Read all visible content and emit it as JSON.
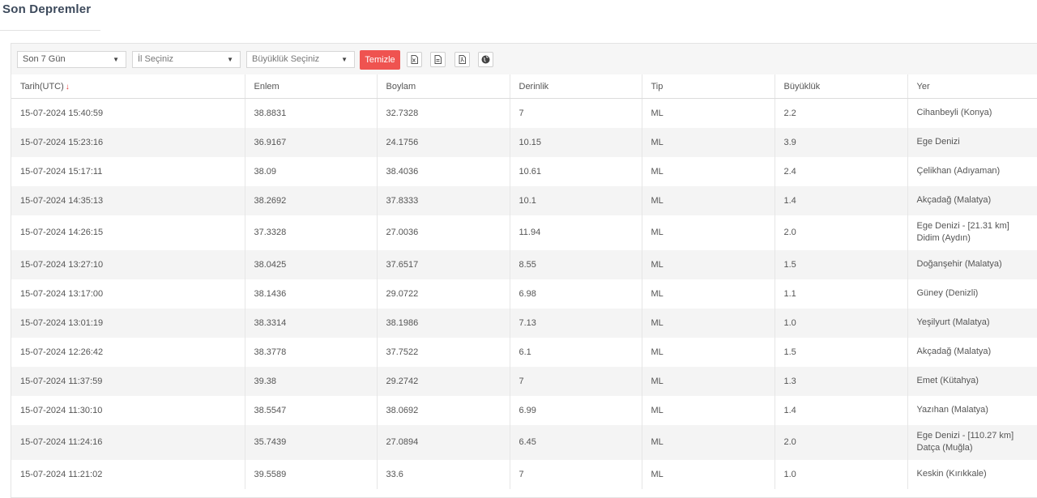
{
  "page": {
    "title": "Son Depremler"
  },
  "filters": {
    "period": "Son 7 Gün",
    "province": "İl Seçiniz",
    "magnitude": "Büyüklük Seçiniz",
    "clear_label": "Temizle"
  },
  "export_icons": [
    "excel-icon",
    "csv-icon",
    "pdf-icon",
    "globe-icon"
  ],
  "columns": [
    "Tarih(UTC)",
    "Enlem",
    "Boylam",
    "Derinlik",
    "Tip",
    "Büyüklük",
    "Yer"
  ],
  "sort": {
    "column": "Tarih(UTC)",
    "direction": "desc",
    "indicator": "↓"
  },
  "rows": [
    {
      "date": "15-07-2024 15:40:59",
      "lat": "38.8831",
      "lon": "32.7328",
      "depth": "7",
      "type": "ML",
      "mag": "2.2",
      "loc": "Cihanbeyli (Konya)"
    },
    {
      "date": "15-07-2024 15:23:16",
      "lat": "36.9167",
      "lon": "24.1756",
      "depth": "10.15",
      "type": "ML",
      "mag": "3.9",
      "loc": "Ege Denizi"
    },
    {
      "date": "15-07-2024 15:17:11",
      "lat": "38.09",
      "lon": "38.4036",
      "depth": "10.61",
      "type": "ML",
      "mag": "2.4",
      "loc": "Çelikhan (Adıyaman)"
    },
    {
      "date": "15-07-2024 14:35:13",
      "lat": "38.2692",
      "lon": "37.8333",
      "depth": "10.1",
      "type": "ML",
      "mag": "1.4",
      "loc": "Akçadağ (Malatya)"
    },
    {
      "date": "15-07-2024 14:26:15",
      "lat": "37.3328",
      "lon": "27.0036",
      "depth": "11.94",
      "type": "ML",
      "mag": "2.0",
      "loc": "Ege Denizi - [21.31 km] Didim (Aydın)"
    },
    {
      "date": "15-07-2024 13:27:10",
      "lat": "38.0425",
      "lon": "37.6517",
      "depth": "8.55",
      "type": "ML",
      "mag": "1.5",
      "loc": "Doğanşehir (Malatya)"
    },
    {
      "date": "15-07-2024 13:17:00",
      "lat": "38.1436",
      "lon": "29.0722",
      "depth": "6.98",
      "type": "ML",
      "mag": "1.1",
      "loc": "Güney (Denizli)"
    },
    {
      "date": "15-07-2024 13:01:19",
      "lat": "38.3314",
      "lon": "38.1986",
      "depth": "7.13",
      "type": "ML",
      "mag": "1.0",
      "loc": "Yeşilyurt (Malatya)"
    },
    {
      "date": "15-07-2024 12:26:42",
      "lat": "38.3778",
      "lon": "37.7522",
      "depth": "6.1",
      "type": "ML",
      "mag": "1.5",
      "loc": "Akçadağ (Malatya)"
    },
    {
      "date": "15-07-2024 11:37:59",
      "lat": "39.38",
      "lon": "29.2742",
      "depth": "7",
      "type": "ML",
      "mag": "1.3",
      "loc": "Emet (Kütahya)"
    },
    {
      "date": "15-07-2024 11:30:10",
      "lat": "38.5547",
      "lon": "38.0692",
      "depth": "6.99",
      "type": "ML",
      "mag": "1.4",
      "loc": "Yazıhan (Malatya)"
    },
    {
      "date": "15-07-2024 11:24:16",
      "lat": "35.7439",
      "lon": "27.0894",
      "depth": "6.45",
      "type": "ML",
      "mag": "2.0",
      "loc": "Ege Denizi - [110.27 km] Datça (Muğla)"
    },
    {
      "date": "15-07-2024 11:21:02",
      "lat": "39.5589",
      "lon": "33.6",
      "depth": "7",
      "type": "ML",
      "mag": "1.0",
      "loc": "Keskin (Kırıkkale)"
    }
  ]
}
